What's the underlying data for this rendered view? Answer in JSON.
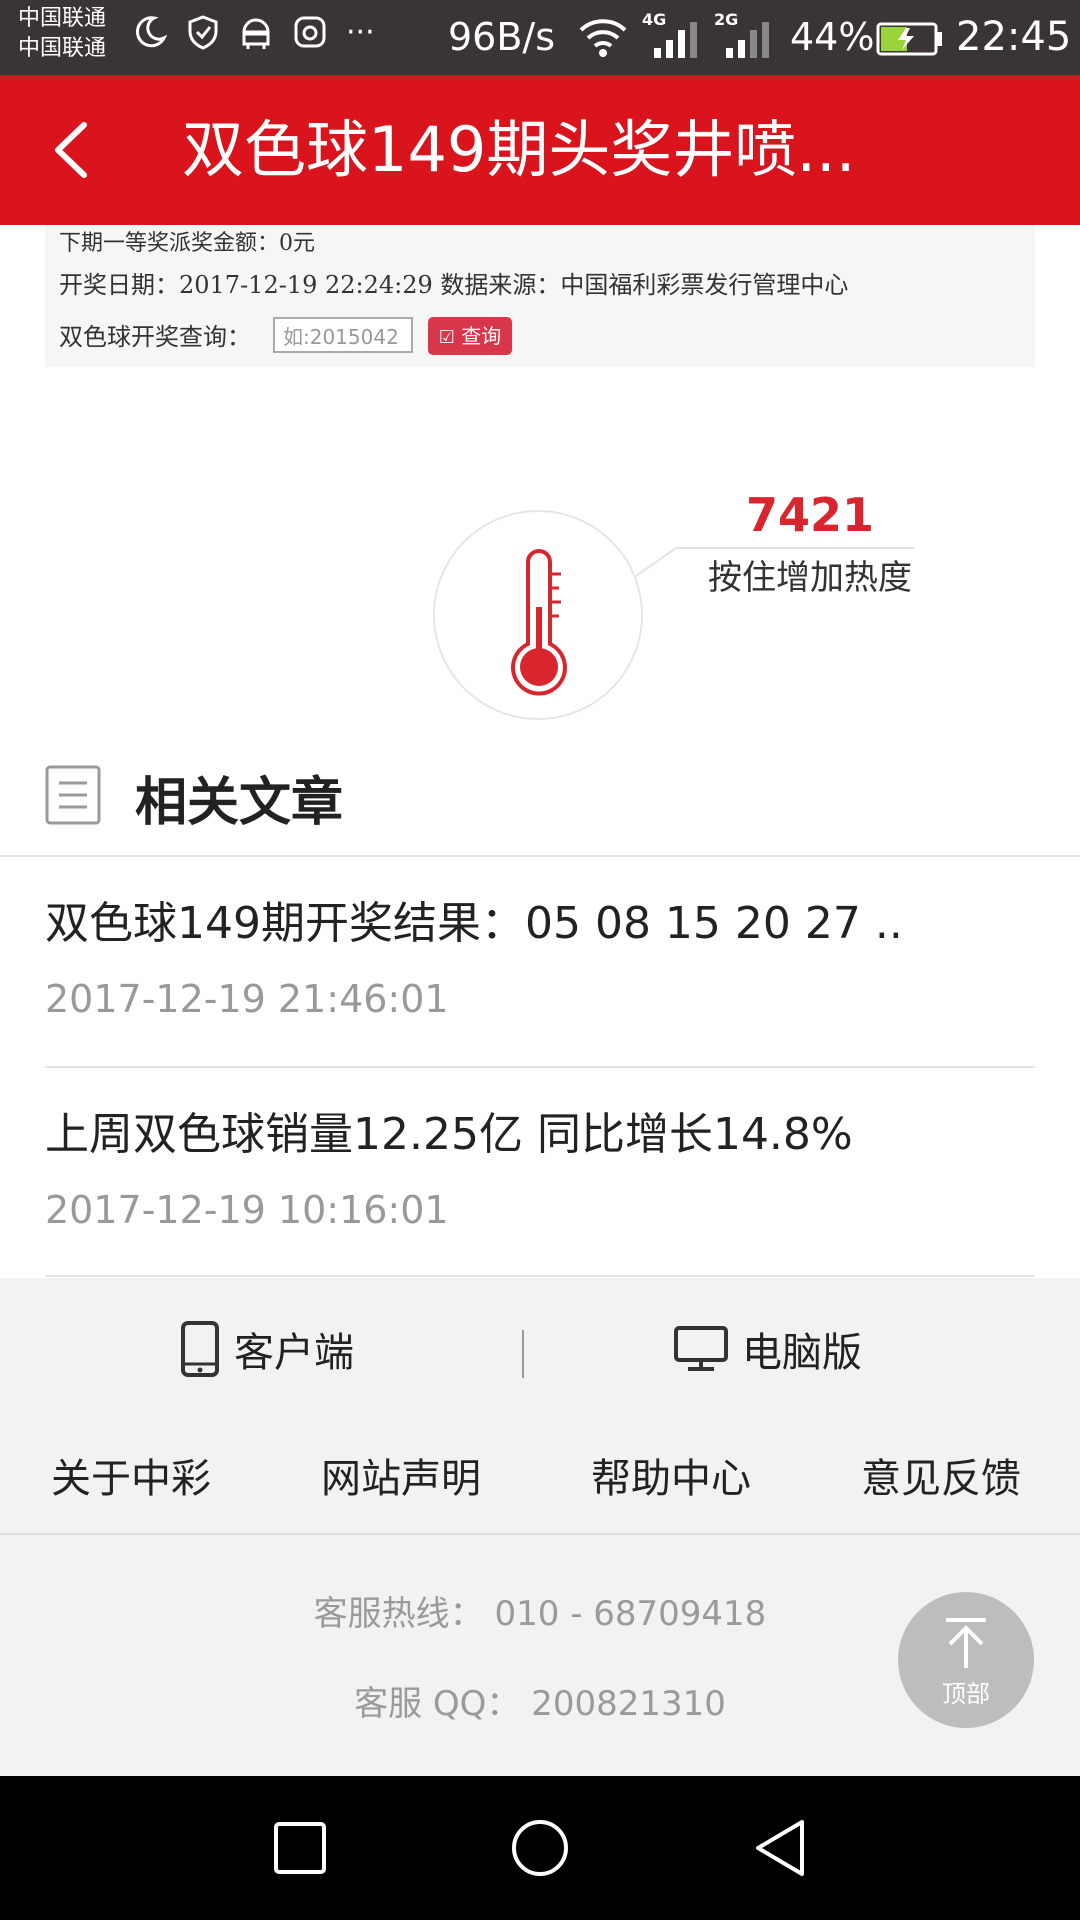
{
  "status_bar": {
    "carrier_1": "中国联通",
    "carrier_2": "中国联通",
    "icons": [
      "moon-icon",
      "shield-icon",
      "android-icon",
      "huawei-icon",
      "more-icon"
    ],
    "more": "···",
    "net_speed": "96B/s",
    "signal_1_label": "4G",
    "signal_2_label": "2G",
    "battery": "44%",
    "time": "22:45"
  },
  "header": {
    "title": "双色球149期头奖井喷...",
    "background": "#d9141c"
  },
  "embed": {
    "line1": "下期一等奖派奖金额：0元",
    "line2": "开奖日期：2017-12-19 22:24:29 数据来源：中国福利彩票发行管理中心",
    "query_label": "双色球开奖查询：",
    "query_placeholder": "如:2015042",
    "query_button": "查询"
  },
  "heat": {
    "count": "7421",
    "label": "按住增加热度",
    "accent": "#d9262e"
  },
  "related": {
    "title": "相关文章",
    "articles": [
      {
        "title": "双色球149期开奖结果：05 08 15 20 27 ..",
        "time": "2017-12-19 21:46:01"
      },
      {
        "title": "上周双色球销量12.25亿 同比增长14.8%",
        "time": "2017-12-19 10:16:01"
      }
    ]
  },
  "footer": {
    "client": "客户端",
    "pc": "电脑版",
    "links": [
      "关于中彩",
      "网站声明",
      "帮助中心",
      "意见反馈"
    ],
    "hotline": "客服热线：  010 - 68709418",
    "qq": "客服 QQ：  200821310",
    "top_button": "顶部"
  },
  "nav_bar": {
    "icons": [
      "recent-apps-icon",
      "home-icon",
      "back-nav-icon"
    ]
  }
}
